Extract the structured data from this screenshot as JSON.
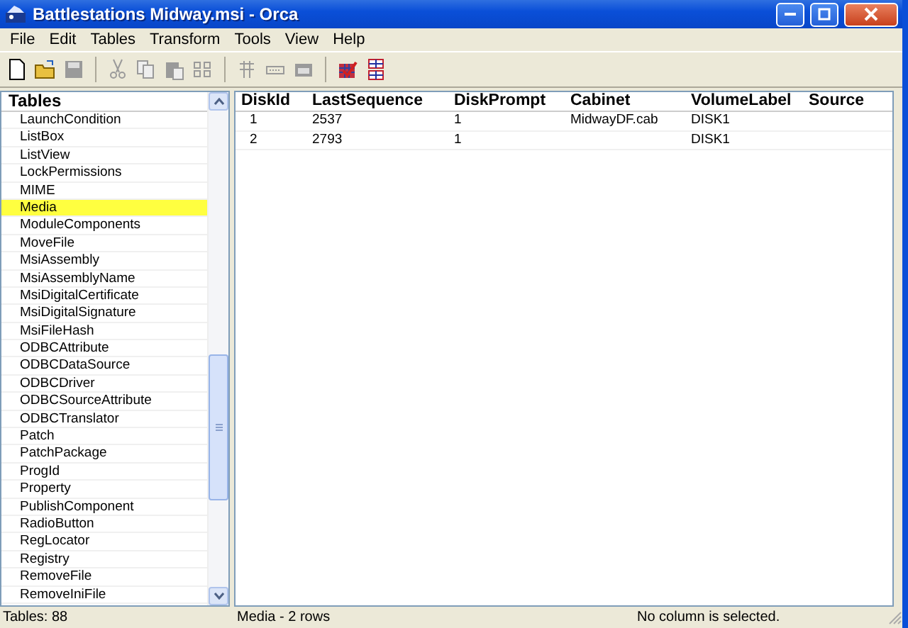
{
  "window": {
    "title": "Battlestations Midway.msi - Orca"
  },
  "menu": [
    "File",
    "Edit",
    "Tables",
    "Transform",
    "Tools",
    "View",
    "Help"
  ],
  "tables": {
    "heading": "Tables",
    "items": [
      {
        "label": "LaunchCondition",
        "selected": false
      },
      {
        "label": "ListBox",
        "selected": false
      },
      {
        "label": "ListView",
        "selected": false
      },
      {
        "label": "LockPermissions",
        "selected": false
      },
      {
        "label": "MIME",
        "selected": false
      },
      {
        "label": "Media",
        "selected": true
      },
      {
        "label": "ModuleComponents",
        "selected": false
      },
      {
        "label": "MoveFile",
        "selected": false
      },
      {
        "label": "MsiAssembly",
        "selected": false
      },
      {
        "label": "MsiAssemblyName",
        "selected": false
      },
      {
        "label": "MsiDigitalCertificate",
        "selected": false
      },
      {
        "label": "MsiDigitalSignature",
        "selected": false
      },
      {
        "label": "MsiFileHash",
        "selected": false
      },
      {
        "label": "ODBCAttribute",
        "selected": false
      },
      {
        "label": "ODBCDataSource",
        "selected": false
      },
      {
        "label": "ODBCDriver",
        "selected": false
      },
      {
        "label": "ODBCSourceAttribute",
        "selected": false
      },
      {
        "label": "ODBCTranslator",
        "selected": false
      },
      {
        "label": "Patch",
        "selected": false
      },
      {
        "label": "PatchPackage",
        "selected": false
      },
      {
        "label": "ProgId",
        "selected": false
      },
      {
        "label": "Property",
        "selected": false
      },
      {
        "label": "PublishComponent",
        "selected": false
      },
      {
        "label": "RadioButton",
        "selected": false
      },
      {
        "label": "RegLocator",
        "selected": false
      },
      {
        "label": "Registry",
        "selected": false
      },
      {
        "label": "RemoveFile",
        "selected": false
      },
      {
        "label": "RemoveIniFile",
        "selected": false
      }
    ]
  },
  "table": {
    "columns": [
      "DiskId",
      "LastSequence",
      "DiskPrompt",
      "Cabinet",
      "VolumeLabel",
      "Source"
    ],
    "rows": [
      [
        "1",
        "2537",
        "1",
        "MidwayDF.cab",
        "DISK1",
        ""
      ],
      [
        "2",
        "2793",
        "1",
        "",
        "DISK1",
        ""
      ]
    ]
  },
  "status_bar": [
    "Tables: 88",
    "Media - 2 rows",
    "No column is selected."
  ]
}
